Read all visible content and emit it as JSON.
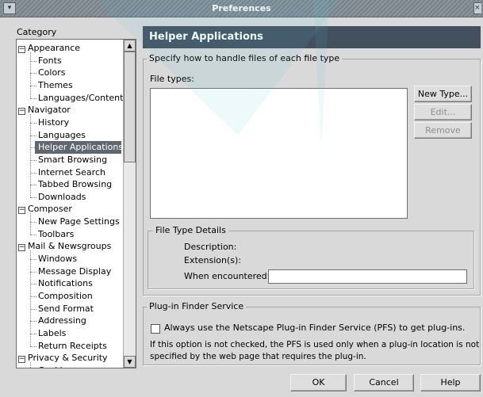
{
  "window": {
    "title": "Preferences",
    "menu_glyph": "▾",
    "close_glyph": "×"
  },
  "category": {
    "label": "Category",
    "items": [
      {
        "label": "Appearance",
        "level": 0,
        "expander": "−"
      },
      {
        "label": "Fonts",
        "level": 1
      },
      {
        "label": "Colors",
        "level": 1
      },
      {
        "label": "Themes",
        "level": 1
      },
      {
        "label": "Languages/Content",
        "level": 1
      },
      {
        "label": "Navigator",
        "level": 0,
        "expander": "−"
      },
      {
        "label": "History",
        "level": 1
      },
      {
        "label": "Languages",
        "level": 1
      },
      {
        "label": "Helper Applications",
        "level": 1,
        "selected": true
      },
      {
        "label": "Smart Browsing",
        "level": 1
      },
      {
        "label": "Internet Search",
        "level": 1
      },
      {
        "label": "Tabbed Browsing",
        "level": 1
      },
      {
        "label": "Downloads",
        "level": 1
      },
      {
        "label": "Composer",
        "level": 0,
        "expander": "−"
      },
      {
        "label": "New Page Settings",
        "level": 1
      },
      {
        "label": "Toolbars",
        "level": 1
      },
      {
        "label": "Mail & Newsgroups",
        "level": 0,
        "expander": "−"
      },
      {
        "label": "Windows",
        "level": 1
      },
      {
        "label": "Message Display",
        "level": 1
      },
      {
        "label": "Notifications",
        "level": 1
      },
      {
        "label": "Composition",
        "level": 1
      },
      {
        "label": "Send Format",
        "level": 1
      },
      {
        "label": "Addressing",
        "level": 1
      },
      {
        "label": "Labels",
        "level": 1
      },
      {
        "label": "Return Receipts",
        "level": 1
      },
      {
        "label": "Privacy & Security",
        "level": 0,
        "expander": "−"
      },
      {
        "label": "Cookies",
        "level": 1
      }
    ],
    "scroll_up_glyph": "▲",
    "scroll_down_glyph": "▼"
  },
  "helper": {
    "header": "Helper Applications",
    "file_group_legend": "Specify how to handle files of each file type",
    "file_types_label": "File types:",
    "new_type_button": "New Type...",
    "edit_button": "Edit...",
    "remove_button": "Remove",
    "details_legend": "File Type Details",
    "description_label": "Description:",
    "extensions_label": "Extension(s):",
    "when_encountered_label": "When encountered:",
    "when_encountered_value": ""
  },
  "plugin_finder": {
    "legend": "Plug-in Finder Service",
    "checkbox_label": "Always use the Netscape Plug-in Finder Service (PFS) to get plug-ins.",
    "checked": false,
    "note_line1": "If this option is not checked, the PFS is used only when a plug-in location is not",
    "note_line2": "specified by the web page that requires the plug-in."
  },
  "footer": {
    "ok_button": "OK",
    "cancel_button": "Cancel",
    "help_button": "Help"
  }
}
